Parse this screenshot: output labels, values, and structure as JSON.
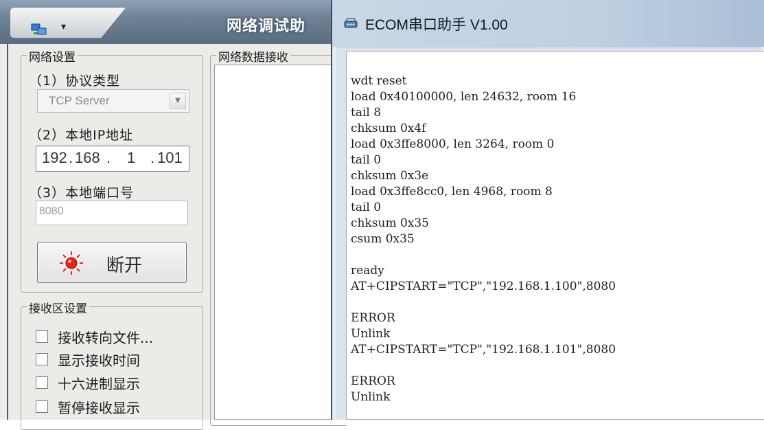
{
  "net_assistant": {
    "title": "网络调试助",
    "app_menu_caret": "▾",
    "settings_group": {
      "title": "网络设置",
      "protocol_label": "（1）协议类型",
      "protocol_value": "TCP Server",
      "local_ip_label": "（2）本地IP地址",
      "ip_parts": [
        "192",
        "168",
        "1",
        "101"
      ],
      "local_port_label": "（3）本地端口号",
      "local_port_value": "8080",
      "disconnect_label": "断开"
    },
    "receive_group": {
      "title": "接收区设置",
      "options": [
        {
          "label": "接收转向文件...",
          "checked": false
        },
        {
          "label": "显示接收时间",
          "checked": false
        },
        {
          "label": "十六进制显示",
          "checked": false
        },
        {
          "label": "暂停接收显示",
          "checked": false
        }
      ]
    },
    "data_receive_title": "网络数据接收"
  },
  "ecom": {
    "title": "ECOM串口助手   V1.00",
    "log_lines": [
      "wdt reset",
      "load 0x40100000, len 24632, room 16",
      "tail 8",
      "chksum 0x4f",
      "load 0x3ffe8000, len 3264, room 0",
      "tail 0",
      "chksum 0x3e",
      "load 0x3ffe8cc0, len 4968, room 8",
      "tail 0",
      "chksum 0x35",
      "csum 0x35",
      "",
      "ready",
      "AT+CIPSTART=\"TCP\",\"192.168.1.100\",8080",
      "",
      "ERROR",
      "Unlink",
      "AT+CIPSTART=\"TCP\",\"192.168.1.101\",8080",
      "",
      "ERROR",
      "Unlink"
    ]
  },
  "colors": {
    "disconnect_indicator": "#e8231e",
    "ecom_titlebar": "#c9d7e6",
    "net_titlebar": "#6f8296"
  },
  "icons": {
    "net_app_icon": "network-app-icon",
    "ecom_app_icon": "serial-port-icon",
    "disconnect_indicator": "red-led-icon"
  }
}
